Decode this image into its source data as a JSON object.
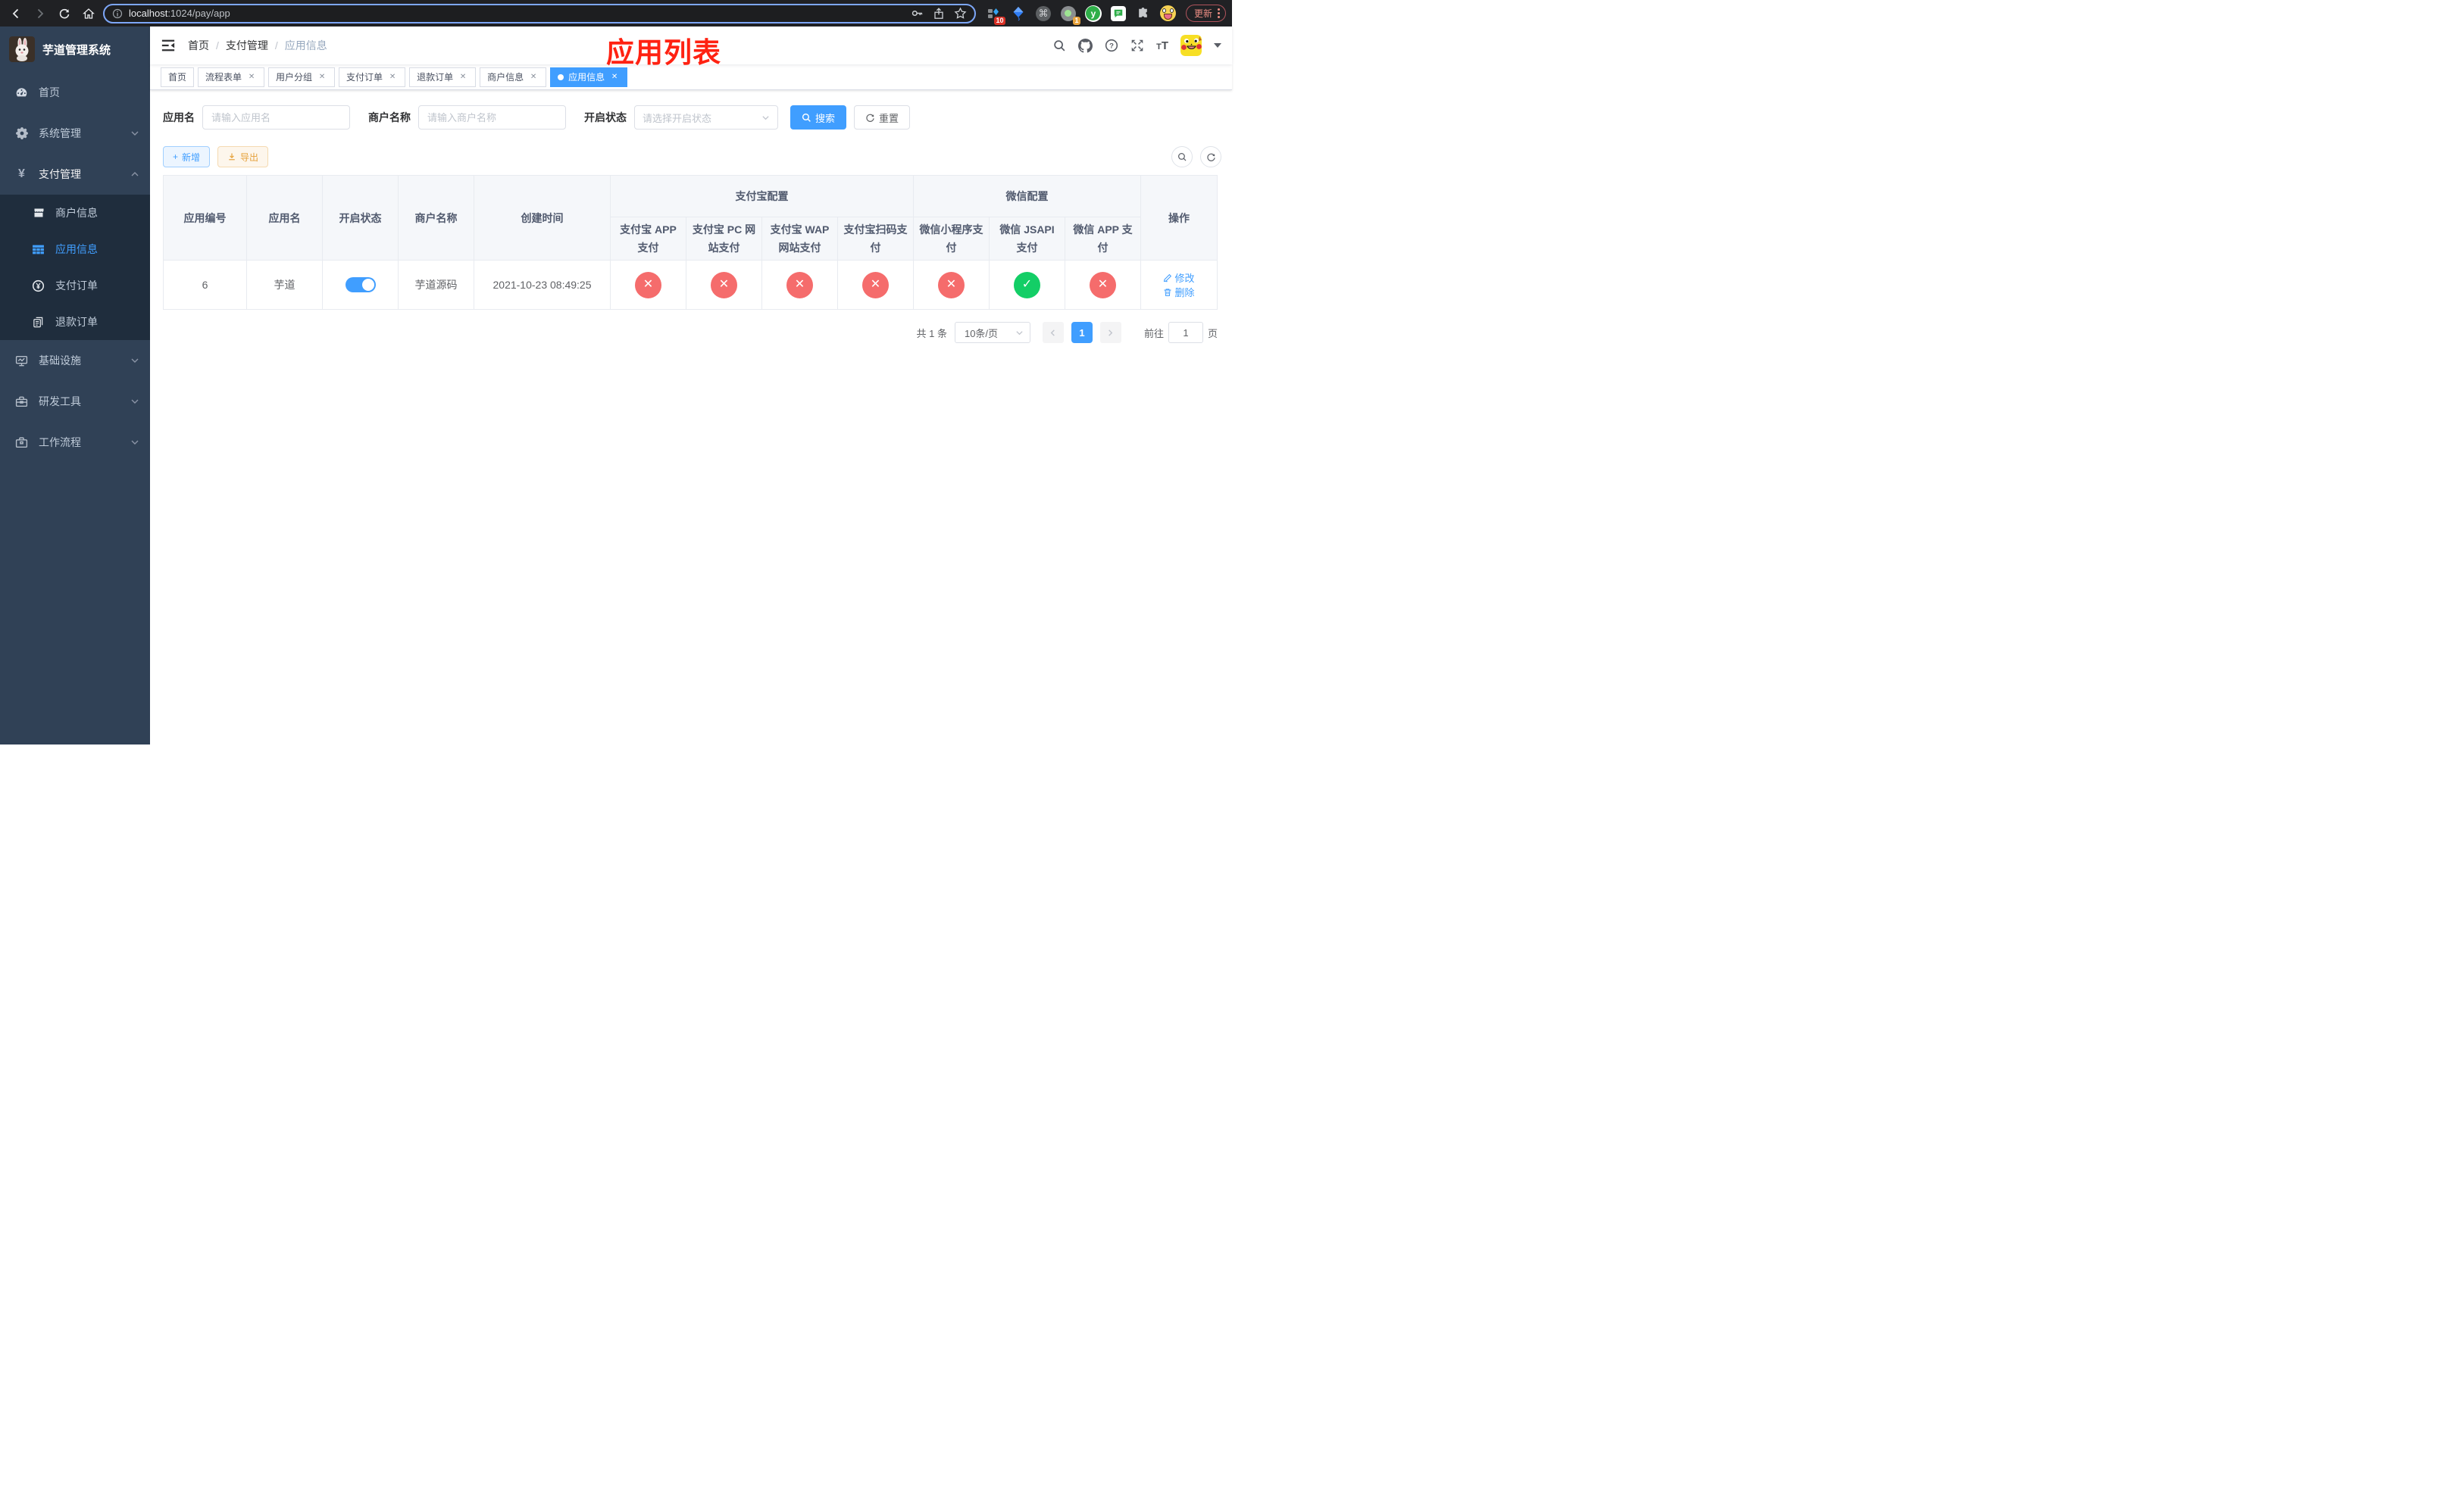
{
  "colors": {
    "accent": "#409eff",
    "success": "#13ce66",
    "danger": "#f56c6c",
    "sidebar_bg": "#304156",
    "submenu_bg": "#1f2d3d"
  },
  "browser": {
    "url_host": "localhost",
    "url_rest": ":1024/pay/app",
    "update_label": "更新",
    "ext_badge_pin": "10",
    "ext_badge_proxy": "1",
    "ext_y_letter": "y",
    "cmd_glyph": "⌘"
  },
  "annotation": {
    "title": "应用列表"
  },
  "sidebar": {
    "title": "芋道管理系统",
    "menu": [
      {
        "label": "首页"
      },
      {
        "label": "系统管理"
      },
      {
        "label": "支付管理"
      },
      {
        "label": "基础设施"
      },
      {
        "label": "研发工具"
      },
      {
        "label": "工作流程"
      }
    ],
    "submenu": [
      {
        "label": "商户信息"
      },
      {
        "label": "应用信息"
      },
      {
        "label": "支付订单"
      },
      {
        "label": "退款订单"
      }
    ],
    "yen": "¥"
  },
  "navbar": {
    "breadcrumb": [
      "首页",
      "支付管理",
      "应用信息"
    ],
    "separator": "/"
  },
  "tabs": [
    {
      "label": "首页"
    },
    {
      "label": "流程表单"
    },
    {
      "label": "用户分组"
    },
    {
      "label": "支付订单"
    },
    {
      "label": "退款订单"
    },
    {
      "label": "商户信息"
    },
    {
      "label": "应用信息"
    }
  ],
  "filters": {
    "app_name_label": "应用名",
    "app_name_placeholder": "请输入应用名",
    "merchant_label": "商户名称",
    "merchant_placeholder": "请输入商户名称",
    "status_label": "开启状态",
    "status_placeholder": "请选择开启状态",
    "search_label": "搜索",
    "reset_label": "重置"
  },
  "toolbar": {
    "add_label": "新增",
    "export_label": "导出"
  },
  "table": {
    "columns": [
      "应用编号",
      "应用名",
      "开启状态",
      "商户名称",
      "创建时间",
      "操作"
    ],
    "groups": [
      {
        "label": "支付宝配置"
      },
      {
        "label": "微信配置"
      }
    ],
    "pay_columns": [
      "支付宝 APP 支付",
      "支付宝 PC 网站支付",
      "支付宝 WAP 网站支付",
      "支付宝扫码支付",
      "微信小程序支付",
      "微信 JSAPI 支付",
      "微信 APP 支付"
    ],
    "row": {
      "id": "6",
      "name": "芋道",
      "enabled": true,
      "merchant": "芋道源码",
      "created": "2021-10-23 08:49:25",
      "statuses": [
        "no",
        "no",
        "no",
        "no",
        "no",
        "yes",
        "no"
      ],
      "ops": [
        "修改",
        "删除"
      ]
    }
  },
  "pagination": {
    "total": "共 1 条",
    "page_size": "10条/页",
    "page": "1",
    "go_prefix": "前往",
    "go_suffix": "页",
    "go_value": "1"
  }
}
